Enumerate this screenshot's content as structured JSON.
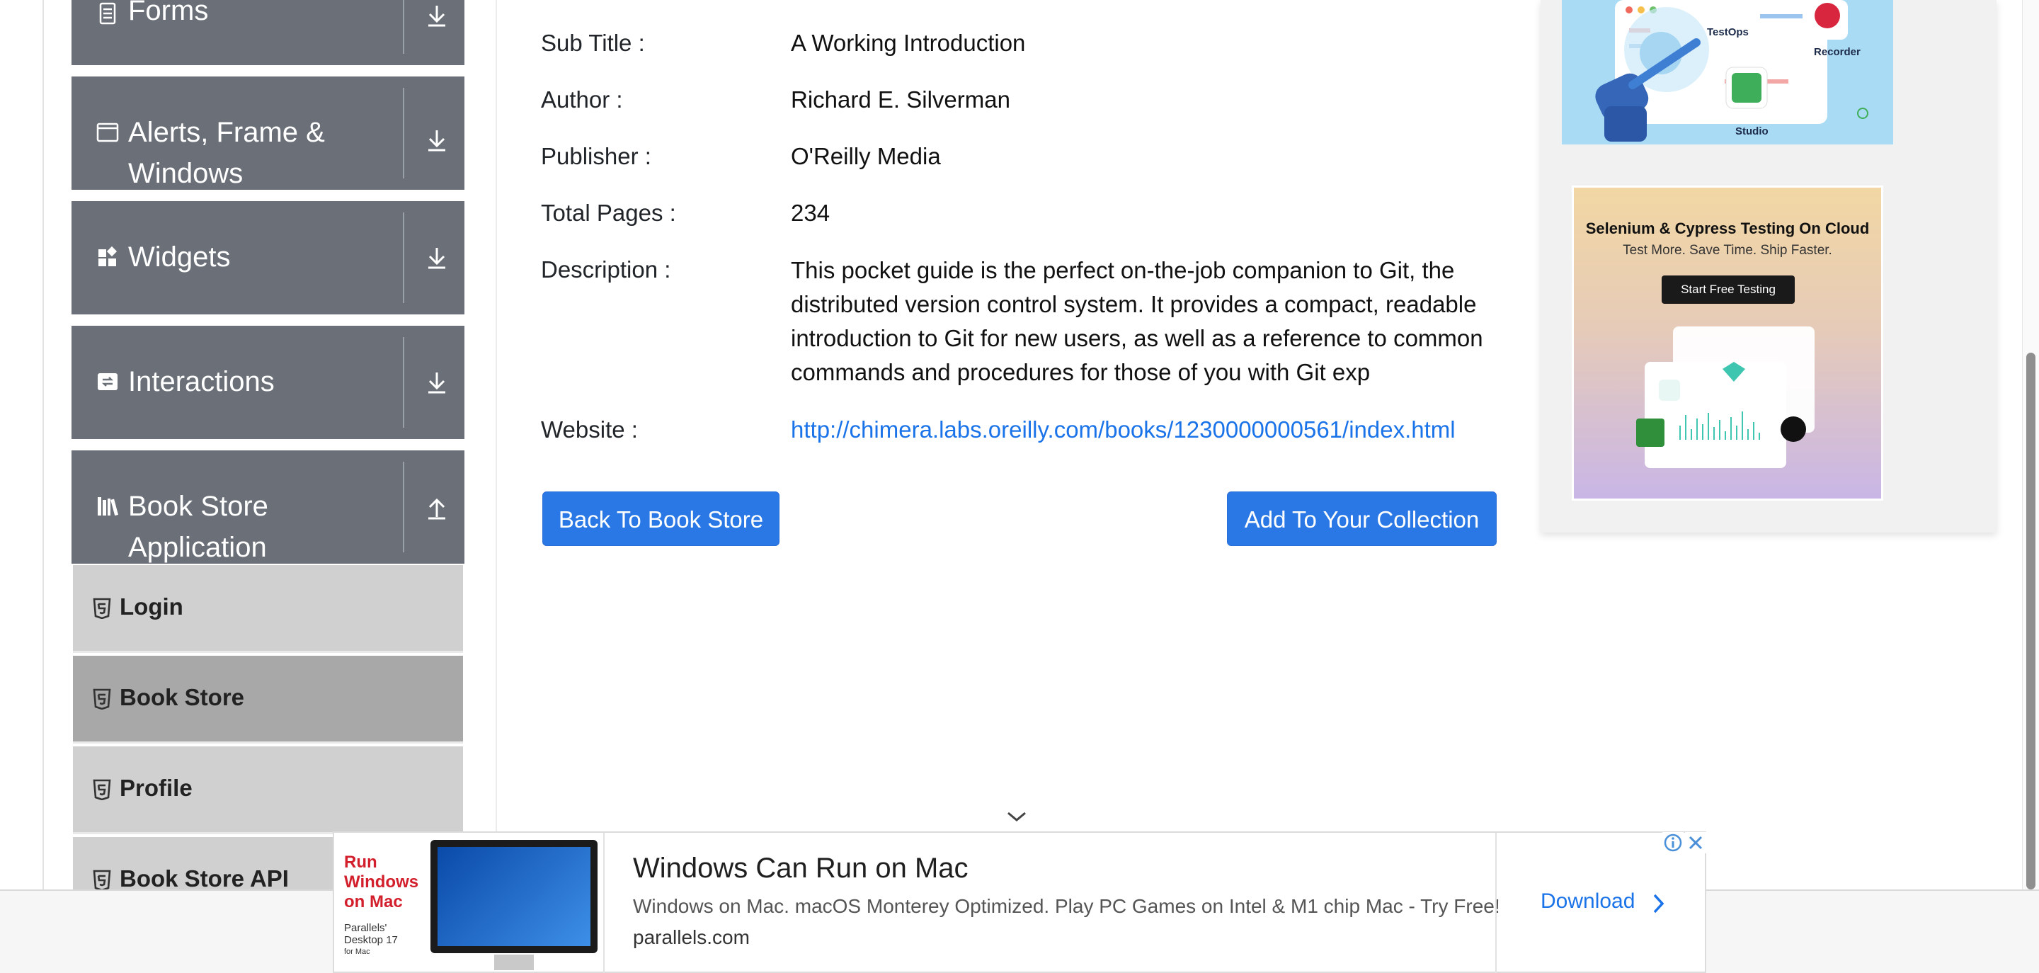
{
  "sidebar": {
    "groups": [
      {
        "label": "Forms"
      },
      {
        "label_line1": "Alerts, Frame &",
        "label_line2": "Windows"
      },
      {
        "label": "Widgets"
      },
      {
        "label": "Interactions"
      },
      {
        "label_line1": "Book Store",
        "label_line2": "Application"
      }
    ],
    "items": [
      {
        "label": "Login"
      },
      {
        "label": "Book Store"
      },
      {
        "label": "Profile"
      },
      {
        "label": "Book Store API"
      }
    ]
  },
  "book": {
    "subtitle_label": "Sub Title :",
    "subtitle": "A Working Introduction",
    "author_label": "Author :",
    "author": "Richard E. Silverman",
    "publisher_label": "Publisher :",
    "publisher": "O'Reilly Media",
    "pages_label": "Total Pages :",
    "pages": "234",
    "description_label": "Description :",
    "description": "This pocket guide is the perfect on-the-job companion to Git, the distributed version control system. It provides a compact, readable introduction to Git for new users, as well as a reference to common commands and procedures for those of you with Git exp",
    "website_label": "Website :",
    "website": "http://chimera.labs.oreilly.com/books/1230000000561/index.html"
  },
  "buttons": {
    "back": "Back To Book Store",
    "add": "Add To Your Collection"
  },
  "right_ads": {
    "katalon": {
      "testops": "TestOps",
      "recorder": "Recorder",
      "studio": "Studio"
    },
    "selenium": {
      "title": "Selenium & Cypress Testing On Cloud",
      "subtitle": "Test More. Save Time. Ship Faster.",
      "cta": "Start Free Testing"
    }
  },
  "bottom_ad": {
    "left_line1": "Run",
    "left_line2": "Windows",
    "left_line3": "on Mac",
    "brand_line1": "Parallels'",
    "brand_line2": "Desktop 17",
    "brand_line3": "for Mac",
    "title": "Windows Can Run on Mac",
    "description": "Windows on Mac. macOS Monterey Optimized. Play PC Games on Intel & M1 chip Mac - Try Free!",
    "domain": "parallels.com",
    "cta": "Download"
  },
  "colors": {
    "sidebar_group": "#6b7078",
    "sidebar_item": "#d0d0d0",
    "sidebar_item_active": "#a8a8a8",
    "primary": "#2a78e6",
    "link": "#1a73e8"
  }
}
